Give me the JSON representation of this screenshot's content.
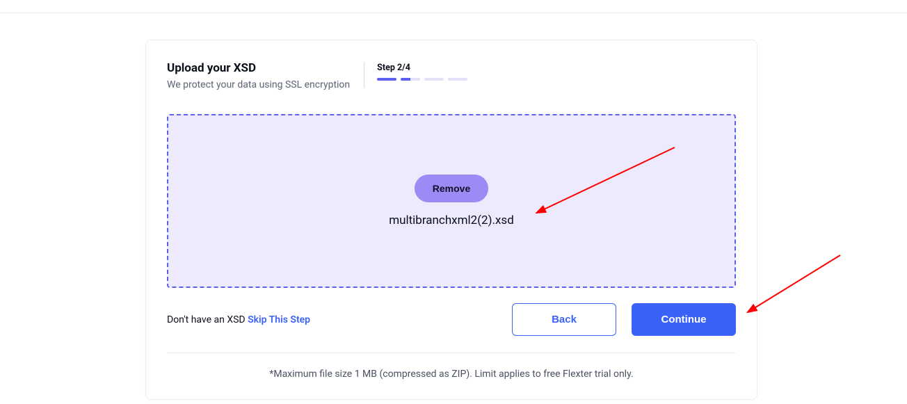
{
  "header": {
    "title": "Upload your XSD",
    "subtitle": "We protect your data using SSL encryption"
  },
  "step": {
    "label": "Step 2/4",
    "current": 2,
    "total": 4
  },
  "dropzone": {
    "remove_label": "Remove",
    "filename": "multibranchxml2(2).xsd"
  },
  "skip": {
    "prefix": "Don't have an XSD ",
    "link": "Skip This Step"
  },
  "buttons": {
    "back": "Back",
    "continue": "Continue"
  },
  "footnote": "*Maximum file size 1 MB (compressed as ZIP). Limit applies to free Flexter trial only."
}
